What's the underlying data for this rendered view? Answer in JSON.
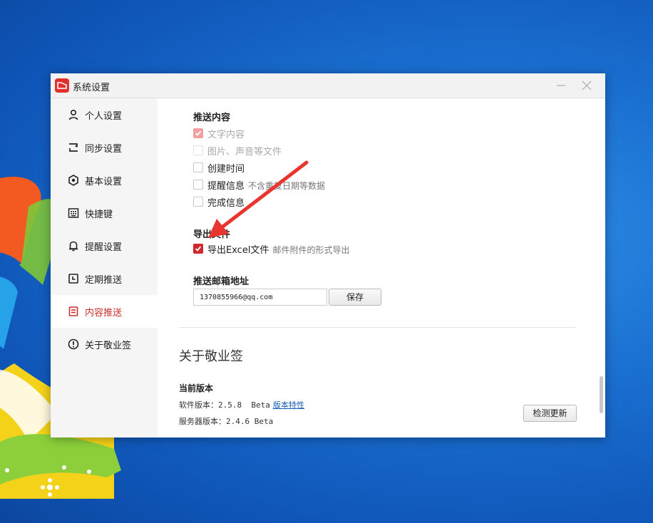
{
  "window": {
    "title": "系统设置"
  },
  "sidebar": {
    "items": [
      {
        "label": "个人设置",
        "icon": "person-icon"
      },
      {
        "label": "同步设置",
        "icon": "sync-icon"
      },
      {
        "label": "基本设置",
        "icon": "settings-icon"
      },
      {
        "label": "快捷键",
        "icon": "keyboard-icon"
      },
      {
        "label": "提醒设置",
        "icon": "bell-icon"
      },
      {
        "label": "定期推送",
        "icon": "calendar-icon"
      },
      {
        "label": "内容推送",
        "icon": "document-icon",
        "active": true
      },
      {
        "label": "关于敬业签",
        "icon": "info-icon"
      }
    ]
  },
  "push_content": {
    "title": "推送内容",
    "options": [
      {
        "label": "文字内容",
        "checked": true,
        "disabled": true
      },
      {
        "label": "图片、声音等文件",
        "checked": false,
        "disabled": true
      },
      {
        "label": "创建时间",
        "checked": false
      },
      {
        "label": "提醒信息",
        "hint": "不含重复日期等数据",
        "checked": false
      },
      {
        "label": "完成信息",
        "checked": false
      }
    ]
  },
  "export_file": {
    "title": "导出文件",
    "option_label": "导出Excel文件",
    "option_hint": "邮件附件的形式导出",
    "checked": true
  },
  "email": {
    "title": "推送邮箱地址",
    "value": "1370855966@qq.com",
    "save_label": "保存"
  },
  "about": {
    "title": "关于敬业签",
    "version_title": "当前版本",
    "software_label": "软件版本：",
    "software_version": "2.5.8  Beta",
    "features_link": "版本特性",
    "server_label": "服务器版本：",
    "server_version": "2.4.6 Beta",
    "check_update_label": "检测更新"
  },
  "colors": {
    "accent": "#d2272c",
    "link": "#1a5fb4",
    "annotation_arrow": "#e8352f"
  }
}
